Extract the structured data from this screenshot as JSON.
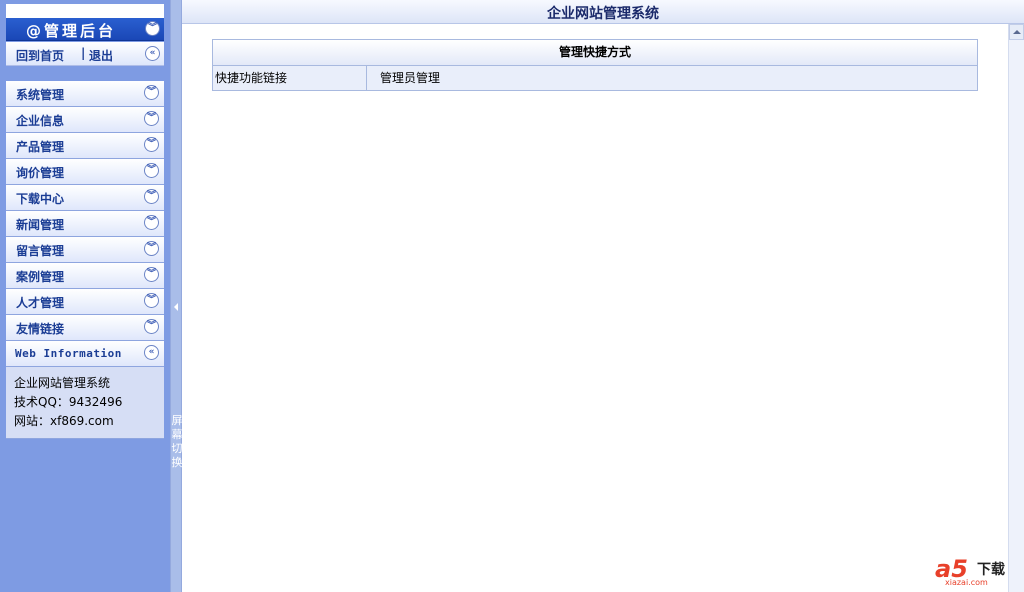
{
  "sidebar": {
    "title": "@管理后台",
    "home_link": "回到首页",
    "separator": "|",
    "logout_link": "退出",
    "menu": [
      {
        "label": "系统管理"
      },
      {
        "label": "企业信息"
      },
      {
        "label": "产品管理"
      },
      {
        "label": "询价管理"
      },
      {
        "label": "下载中心"
      },
      {
        "label": "新闻管理"
      },
      {
        "label": "留言管理"
      },
      {
        "label": "案例管理"
      },
      {
        "label": "人才管理"
      },
      {
        "label": "友情链接"
      }
    ],
    "info": {
      "heading": "Web Information",
      "line1": "企业网站管理系统",
      "line2": "技术QQ：9432496",
      "line3": "网站：xf869.com"
    }
  },
  "splitter": {
    "label": "屏幕切换"
  },
  "main": {
    "title": "企业网站管理系统",
    "panel": {
      "heading": "管理快捷方式",
      "row_label": "快捷功能链接",
      "row_link": "管理员管理"
    }
  },
  "watermark": {
    "logo": "a5",
    "text": "下载",
    "url": "xiazai.com"
  }
}
